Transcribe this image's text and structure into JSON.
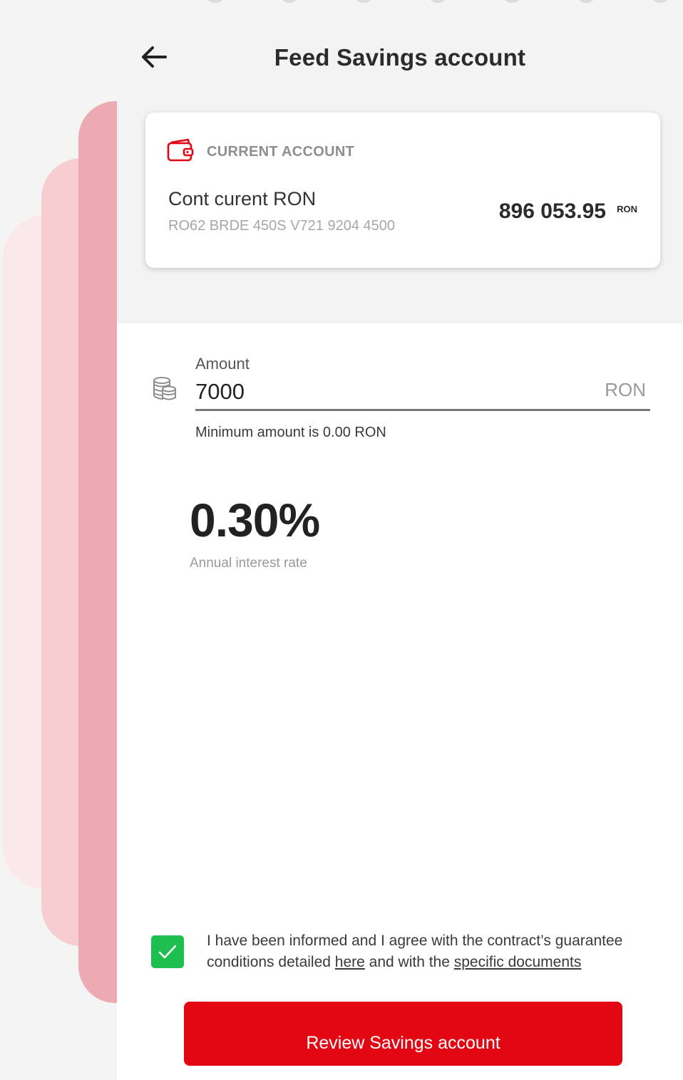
{
  "header": {
    "title": "Feed Savings account"
  },
  "account": {
    "type_label": "CURRENT ACCOUNT",
    "name": "Cont curent RON",
    "iban": "RO62 BRDE 450S V721 9204 4500",
    "balance": "896 053.95",
    "currency": "RON"
  },
  "amount": {
    "label": "Amount",
    "value": "7000",
    "currency": "RON",
    "hint": "Minimum amount is 0.00 RON"
  },
  "interest": {
    "rate": "0.30%",
    "caption": "Annual interest rate"
  },
  "consent": {
    "checked": true,
    "text_before": "I have been informed and I agree with the contract’s guarantee conditions detailed ",
    "link_here": "here",
    "text_middle": " and with the ",
    "link_documents": "specific documents"
  },
  "cta": {
    "label": "Review Savings account"
  },
  "colors": {
    "brand_red": "#e30613",
    "check_green": "#1dbf4f"
  },
  "icons": {
    "back": "arrow-left-icon",
    "wallet": "wallet-icon",
    "amount": "coins-icon",
    "checkbox": "checkmark-icon"
  }
}
